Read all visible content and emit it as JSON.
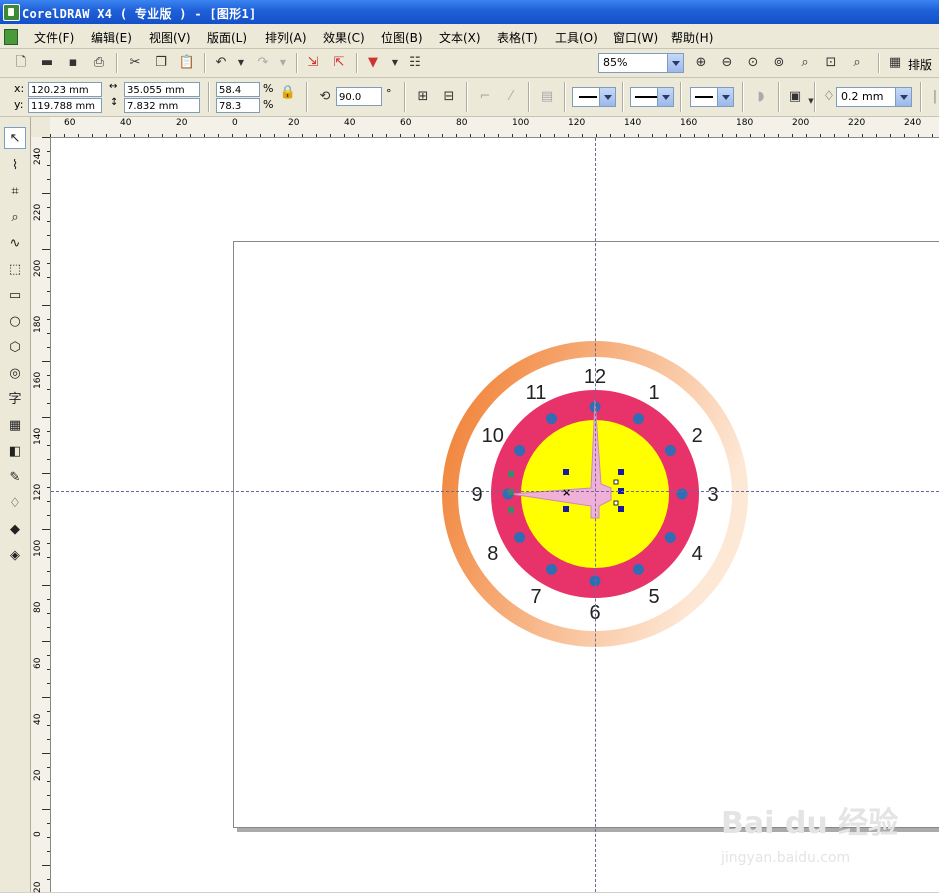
{
  "window": {
    "title": "CorelDRAW X4 ( 专业版 ) - [图形1]"
  },
  "menu": {
    "items": [
      "文件(F)",
      "编辑(E)",
      "视图(V)",
      "版面(L)",
      "排列(A)",
      "效果(C)",
      "位图(B)",
      "文本(X)",
      "表格(T)",
      "工具(O)",
      "窗口(W)",
      "帮助(H)"
    ]
  },
  "standard_toolbar": {
    "zoom_value": "85%",
    "layout_button": "排版"
  },
  "property_bar": {
    "x_label": "x:",
    "x_value": "120.23 mm",
    "y_label": "y:",
    "y_value": "119.788 mm",
    "width_value": "35.055 mm",
    "height_value": "7.832 mm",
    "scale_x": "58.4",
    "scale_y": "78.3",
    "percent": "%",
    "rotation_value": "90.0",
    "degree": "°",
    "outline_width": "0.2 mm"
  },
  "rulers": {
    "horizontal_labels": [
      "60",
      "40",
      "20",
      "0",
      "20",
      "40",
      "60",
      "80",
      "100",
      "120",
      "140",
      "160",
      "180",
      "200",
      "220",
      "240"
    ],
    "vertical_labels": [
      "240",
      "220",
      "200",
      "180",
      "160",
      "140",
      "120",
      "100",
      "80",
      "60",
      "40",
      "20",
      "0",
      "20"
    ]
  },
  "clock": {
    "numerals": [
      "12",
      "1",
      "2",
      "3",
      "4",
      "5",
      "6",
      "7",
      "8",
      "9",
      "10",
      "11"
    ],
    "colors": {
      "ring": "#f07a2a",
      "ring_light": "#fde8d6",
      "face": "#ffffff",
      "band": "#e8336a",
      "center": "#ffff00",
      "dots": "#2f6db4",
      "hand": "#f0b0d8",
      "selection": "#1a1aa0"
    }
  },
  "watermark": {
    "brand": "Bai du 经验",
    "url": "jingyan.baidu.com"
  }
}
